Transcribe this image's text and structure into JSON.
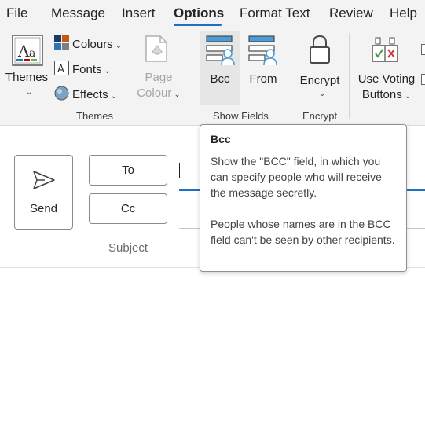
{
  "menu": {
    "tabs": [
      {
        "label": "File"
      },
      {
        "label": "Message"
      },
      {
        "label": "Insert"
      },
      {
        "label": "Options",
        "active": true
      },
      {
        "label": "Format Text"
      },
      {
        "label": "Review"
      },
      {
        "label": "Help"
      }
    ]
  },
  "ribbon": {
    "themes_group": {
      "themes_label": "Themes",
      "colours_label": "Colours",
      "fonts_label": "Fonts",
      "effects_label": "Effects",
      "page_colour_line1": "Page",
      "page_colour_line2": "Colour",
      "group_label": "Themes"
    },
    "show_fields_group": {
      "bcc_label": "Bcc",
      "from_label": "From",
      "group_label": "Show Fields"
    },
    "encrypt_group": {
      "encrypt_label": "Encrypt",
      "group_label": "Encrypt"
    },
    "tracking_group": {
      "voting_line1": "Use Voting",
      "voting_line2": "Buttons"
    },
    "icons": [
      "themes-icon",
      "colours-icon",
      "fonts-icon",
      "effects-icon",
      "page-colour-icon",
      "bcc-icon",
      "from-icon",
      "lock-icon",
      "voting-icon",
      "chevron-down-icon"
    ]
  },
  "compose": {
    "send_label": "Send",
    "to_label": "To",
    "cc_label": "Cc",
    "subject_label": "Subject"
  },
  "tooltip": {
    "title": "Bcc",
    "paragraph1": "Show the \"BCC\" field, in which you can specify people who will receive the message secretly.",
    "paragraph2": "People whose names are in the BCC field can't be seen by other recipients."
  },
  "colors": {
    "accent": "#1e6fc7",
    "ribbon_bg": "#f3f3f3",
    "icon_blue": "#4a9bd6"
  }
}
